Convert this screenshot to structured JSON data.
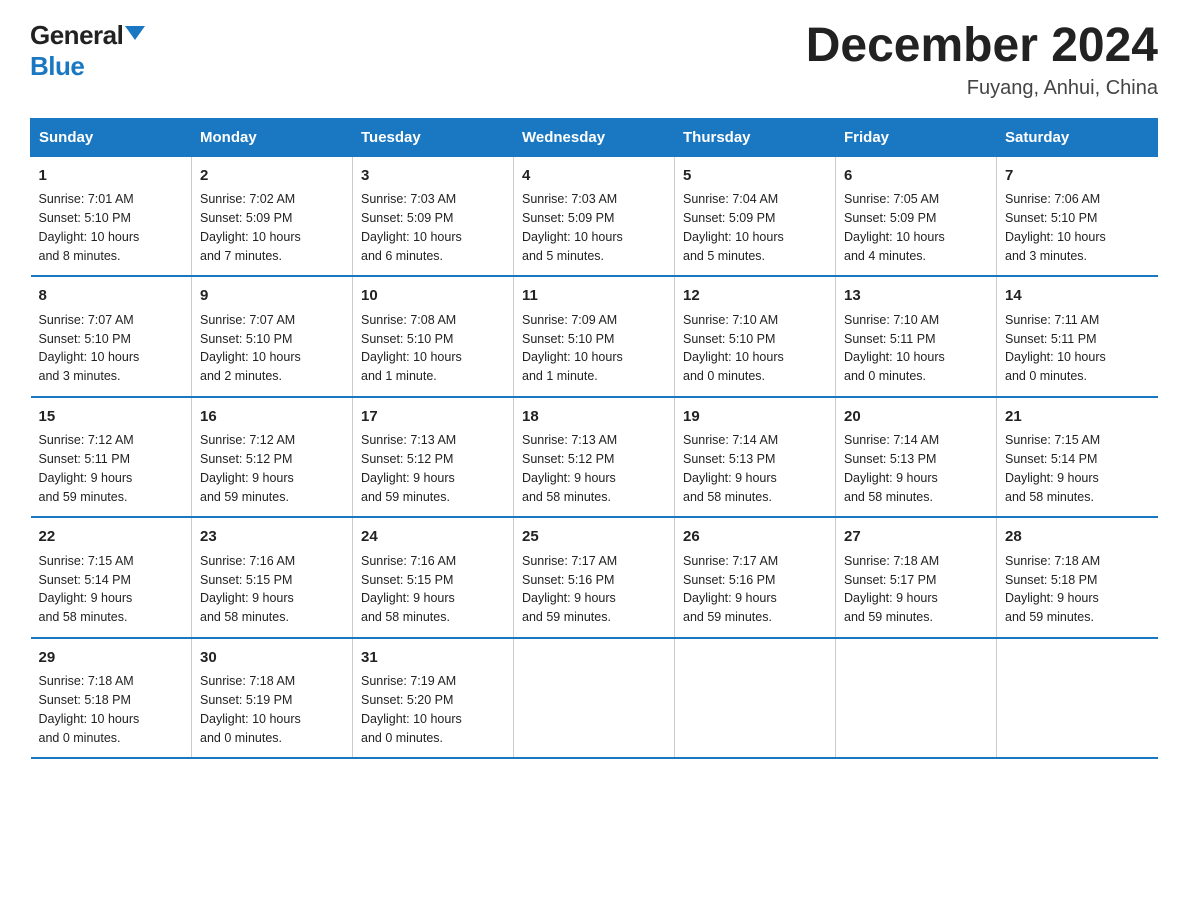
{
  "logo": {
    "general": "General",
    "blue": "Blue"
  },
  "header": {
    "title": "December 2024",
    "location": "Fuyang, Anhui, China"
  },
  "days_of_week": [
    "Sunday",
    "Monday",
    "Tuesday",
    "Wednesday",
    "Thursday",
    "Friday",
    "Saturday"
  ],
  "weeks": [
    [
      {
        "day": "1",
        "sunrise": "7:01 AM",
        "sunset": "5:10 PM",
        "daylight": "10 hours and 8 minutes."
      },
      {
        "day": "2",
        "sunrise": "7:02 AM",
        "sunset": "5:09 PM",
        "daylight": "10 hours and 7 minutes."
      },
      {
        "day": "3",
        "sunrise": "7:03 AM",
        "sunset": "5:09 PM",
        "daylight": "10 hours and 6 minutes."
      },
      {
        "day": "4",
        "sunrise": "7:03 AM",
        "sunset": "5:09 PM",
        "daylight": "10 hours and 5 minutes."
      },
      {
        "day": "5",
        "sunrise": "7:04 AM",
        "sunset": "5:09 PM",
        "daylight": "10 hours and 5 minutes."
      },
      {
        "day": "6",
        "sunrise": "7:05 AM",
        "sunset": "5:09 PM",
        "daylight": "10 hours and 4 minutes."
      },
      {
        "day": "7",
        "sunrise": "7:06 AM",
        "sunset": "5:10 PM",
        "daylight": "10 hours and 3 minutes."
      }
    ],
    [
      {
        "day": "8",
        "sunrise": "7:07 AM",
        "sunset": "5:10 PM",
        "daylight": "10 hours and 3 minutes."
      },
      {
        "day": "9",
        "sunrise": "7:07 AM",
        "sunset": "5:10 PM",
        "daylight": "10 hours and 2 minutes."
      },
      {
        "day": "10",
        "sunrise": "7:08 AM",
        "sunset": "5:10 PM",
        "daylight": "10 hours and 1 minute."
      },
      {
        "day": "11",
        "sunrise": "7:09 AM",
        "sunset": "5:10 PM",
        "daylight": "10 hours and 1 minute."
      },
      {
        "day": "12",
        "sunrise": "7:10 AM",
        "sunset": "5:10 PM",
        "daylight": "10 hours and 0 minutes."
      },
      {
        "day": "13",
        "sunrise": "7:10 AM",
        "sunset": "5:11 PM",
        "daylight": "10 hours and 0 minutes."
      },
      {
        "day": "14",
        "sunrise": "7:11 AM",
        "sunset": "5:11 PM",
        "daylight": "10 hours and 0 minutes."
      }
    ],
    [
      {
        "day": "15",
        "sunrise": "7:12 AM",
        "sunset": "5:11 PM",
        "daylight": "9 hours and 59 minutes."
      },
      {
        "day": "16",
        "sunrise": "7:12 AM",
        "sunset": "5:12 PM",
        "daylight": "9 hours and 59 minutes."
      },
      {
        "day": "17",
        "sunrise": "7:13 AM",
        "sunset": "5:12 PM",
        "daylight": "9 hours and 59 minutes."
      },
      {
        "day": "18",
        "sunrise": "7:13 AM",
        "sunset": "5:12 PM",
        "daylight": "9 hours and 58 minutes."
      },
      {
        "day": "19",
        "sunrise": "7:14 AM",
        "sunset": "5:13 PM",
        "daylight": "9 hours and 58 minutes."
      },
      {
        "day": "20",
        "sunrise": "7:14 AM",
        "sunset": "5:13 PM",
        "daylight": "9 hours and 58 minutes."
      },
      {
        "day": "21",
        "sunrise": "7:15 AM",
        "sunset": "5:14 PM",
        "daylight": "9 hours and 58 minutes."
      }
    ],
    [
      {
        "day": "22",
        "sunrise": "7:15 AM",
        "sunset": "5:14 PM",
        "daylight": "9 hours and 58 minutes."
      },
      {
        "day": "23",
        "sunrise": "7:16 AM",
        "sunset": "5:15 PM",
        "daylight": "9 hours and 58 minutes."
      },
      {
        "day": "24",
        "sunrise": "7:16 AM",
        "sunset": "5:15 PM",
        "daylight": "9 hours and 58 minutes."
      },
      {
        "day": "25",
        "sunrise": "7:17 AM",
        "sunset": "5:16 PM",
        "daylight": "9 hours and 59 minutes."
      },
      {
        "day": "26",
        "sunrise": "7:17 AM",
        "sunset": "5:16 PM",
        "daylight": "9 hours and 59 minutes."
      },
      {
        "day": "27",
        "sunrise": "7:18 AM",
        "sunset": "5:17 PM",
        "daylight": "9 hours and 59 minutes."
      },
      {
        "day": "28",
        "sunrise": "7:18 AM",
        "sunset": "5:18 PM",
        "daylight": "9 hours and 59 minutes."
      }
    ],
    [
      {
        "day": "29",
        "sunrise": "7:18 AM",
        "sunset": "5:18 PM",
        "daylight": "10 hours and 0 minutes."
      },
      {
        "day": "30",
        "sunrise": "7:18 AM",
        "sunset": "5:19 PM",
        "daylight": "10 hours and 0 minutes."
      },
      {
        "day": "31",
        "sunrise": "7:19 AM",
        "sunset": "5:20 PM",
        "daylight": "10 hours and 0 minutes."
      },
      null,
      null,
      null,
      null
    ]
  ],
  "labels": {
    "sunrise": "Sunrise:",
    "sunset": "Sunset:",
    "daylight": "Daylight:"
  }
}
